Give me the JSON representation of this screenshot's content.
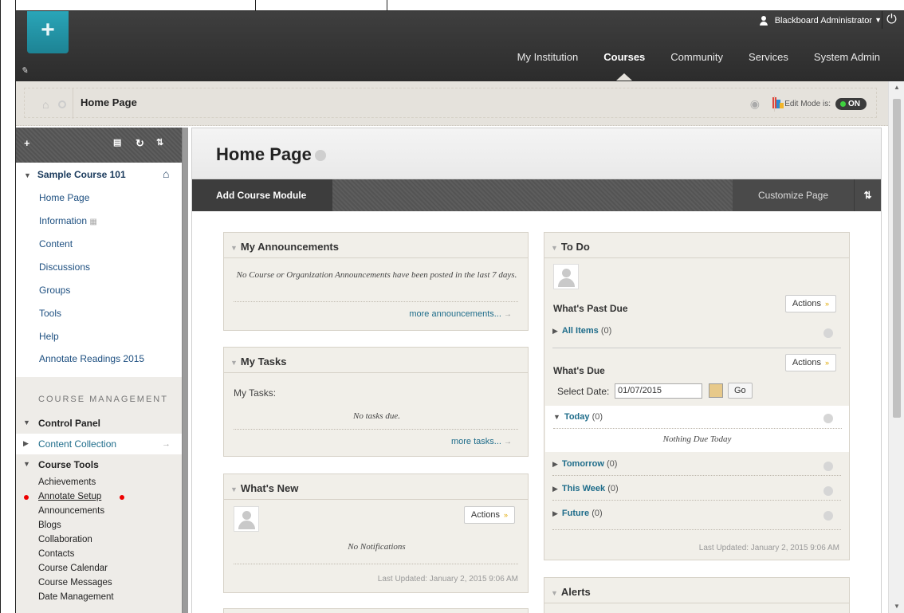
{
  "topbar": {
    "user_name": "Blackboard Administrator",
    "nav": [
      "My Institution",
      "Courses",
      "Community",
      "Services",
      "System Admin"
    ]
  },
  "breadcrumb": {
    "title": "Home Page",
    "edit_mode_label": "Edit Mode is:",
    "edit_mode_value": "ON"
  },
  "sidebar": {
    "course_title": "Sample Course 101",
    "menu": [
      "Home Page",
      "Information",
      "Content",
      "Discussions",
      "Groups",
      "Tools",
      "Help",
      "Annotate Readings 2015"
    ],
    "management_title": "COURSE MANAGEMENT",
    "control_panel": "Control Panel",
    "content_collection": "Content Collection",
    "course_tools": "Course Tools",
    "tools": [
      "Achievements",
      "Annotate Setup",
      "Announcements",
      "Blogs",
      "Collaboration",
      "Contacts",
      "Course Calendar",
      "Course Messages",
      "Date Management"
    ]
  },
  "main": {
    "page_title": "Home Page",
    "add_module": "Add Course Module",
    "customize": "Customize Page"
  },
  "announcements": {
    "title": "My Announcements",
    "empty": "No Course or Organization Announcements have been posted in the last 7 days.",
    "more": "more announcements..."
  },
  "tasks": {
    "title": "My Tasks",
    "label": "My Tasks:",
    "empty": "No tasks due.",
    "more": "more tasks..."
  },
  "whatsnew": {
    "title": "What's New",
    "actions": "Actions",
    "empty": "No Notifications",
    "updated": "Last Updated: January 2, 2015 9:06 AM"
  },
  "todo": {
    "title": "To Do",
    "past_due": "What's Past Due",
    "actions": "Actions",
    "all_items": "All Items",
    "all_items_count": "(0)",
    "whats_due": "What's Due",
    "select_date": "Select Date:",
    "date_value": "01/07/2015",
    "go": "Go",
    "today": "Today",
    "today_count": "(0)",
    "nothing_today": "Nothing Due Today",
    "tomorrow": "Tomorrow",
    "tomorrow_count": "(0)",
    "this_week": "This Week",
    "this_week_count": "(0)",
    "future": "Future",
    "future_count": "(0)",
    "updated": "Last Updated: January 2, 2015 9:06 AM"
  },
  "alerts": {
    "title": "Alerts"
  },
  "colors": {
    "accent": "#1d8394",
    "link": "#1e6c8a",
    "toggle_on": "#3fd13f"
  }
}
